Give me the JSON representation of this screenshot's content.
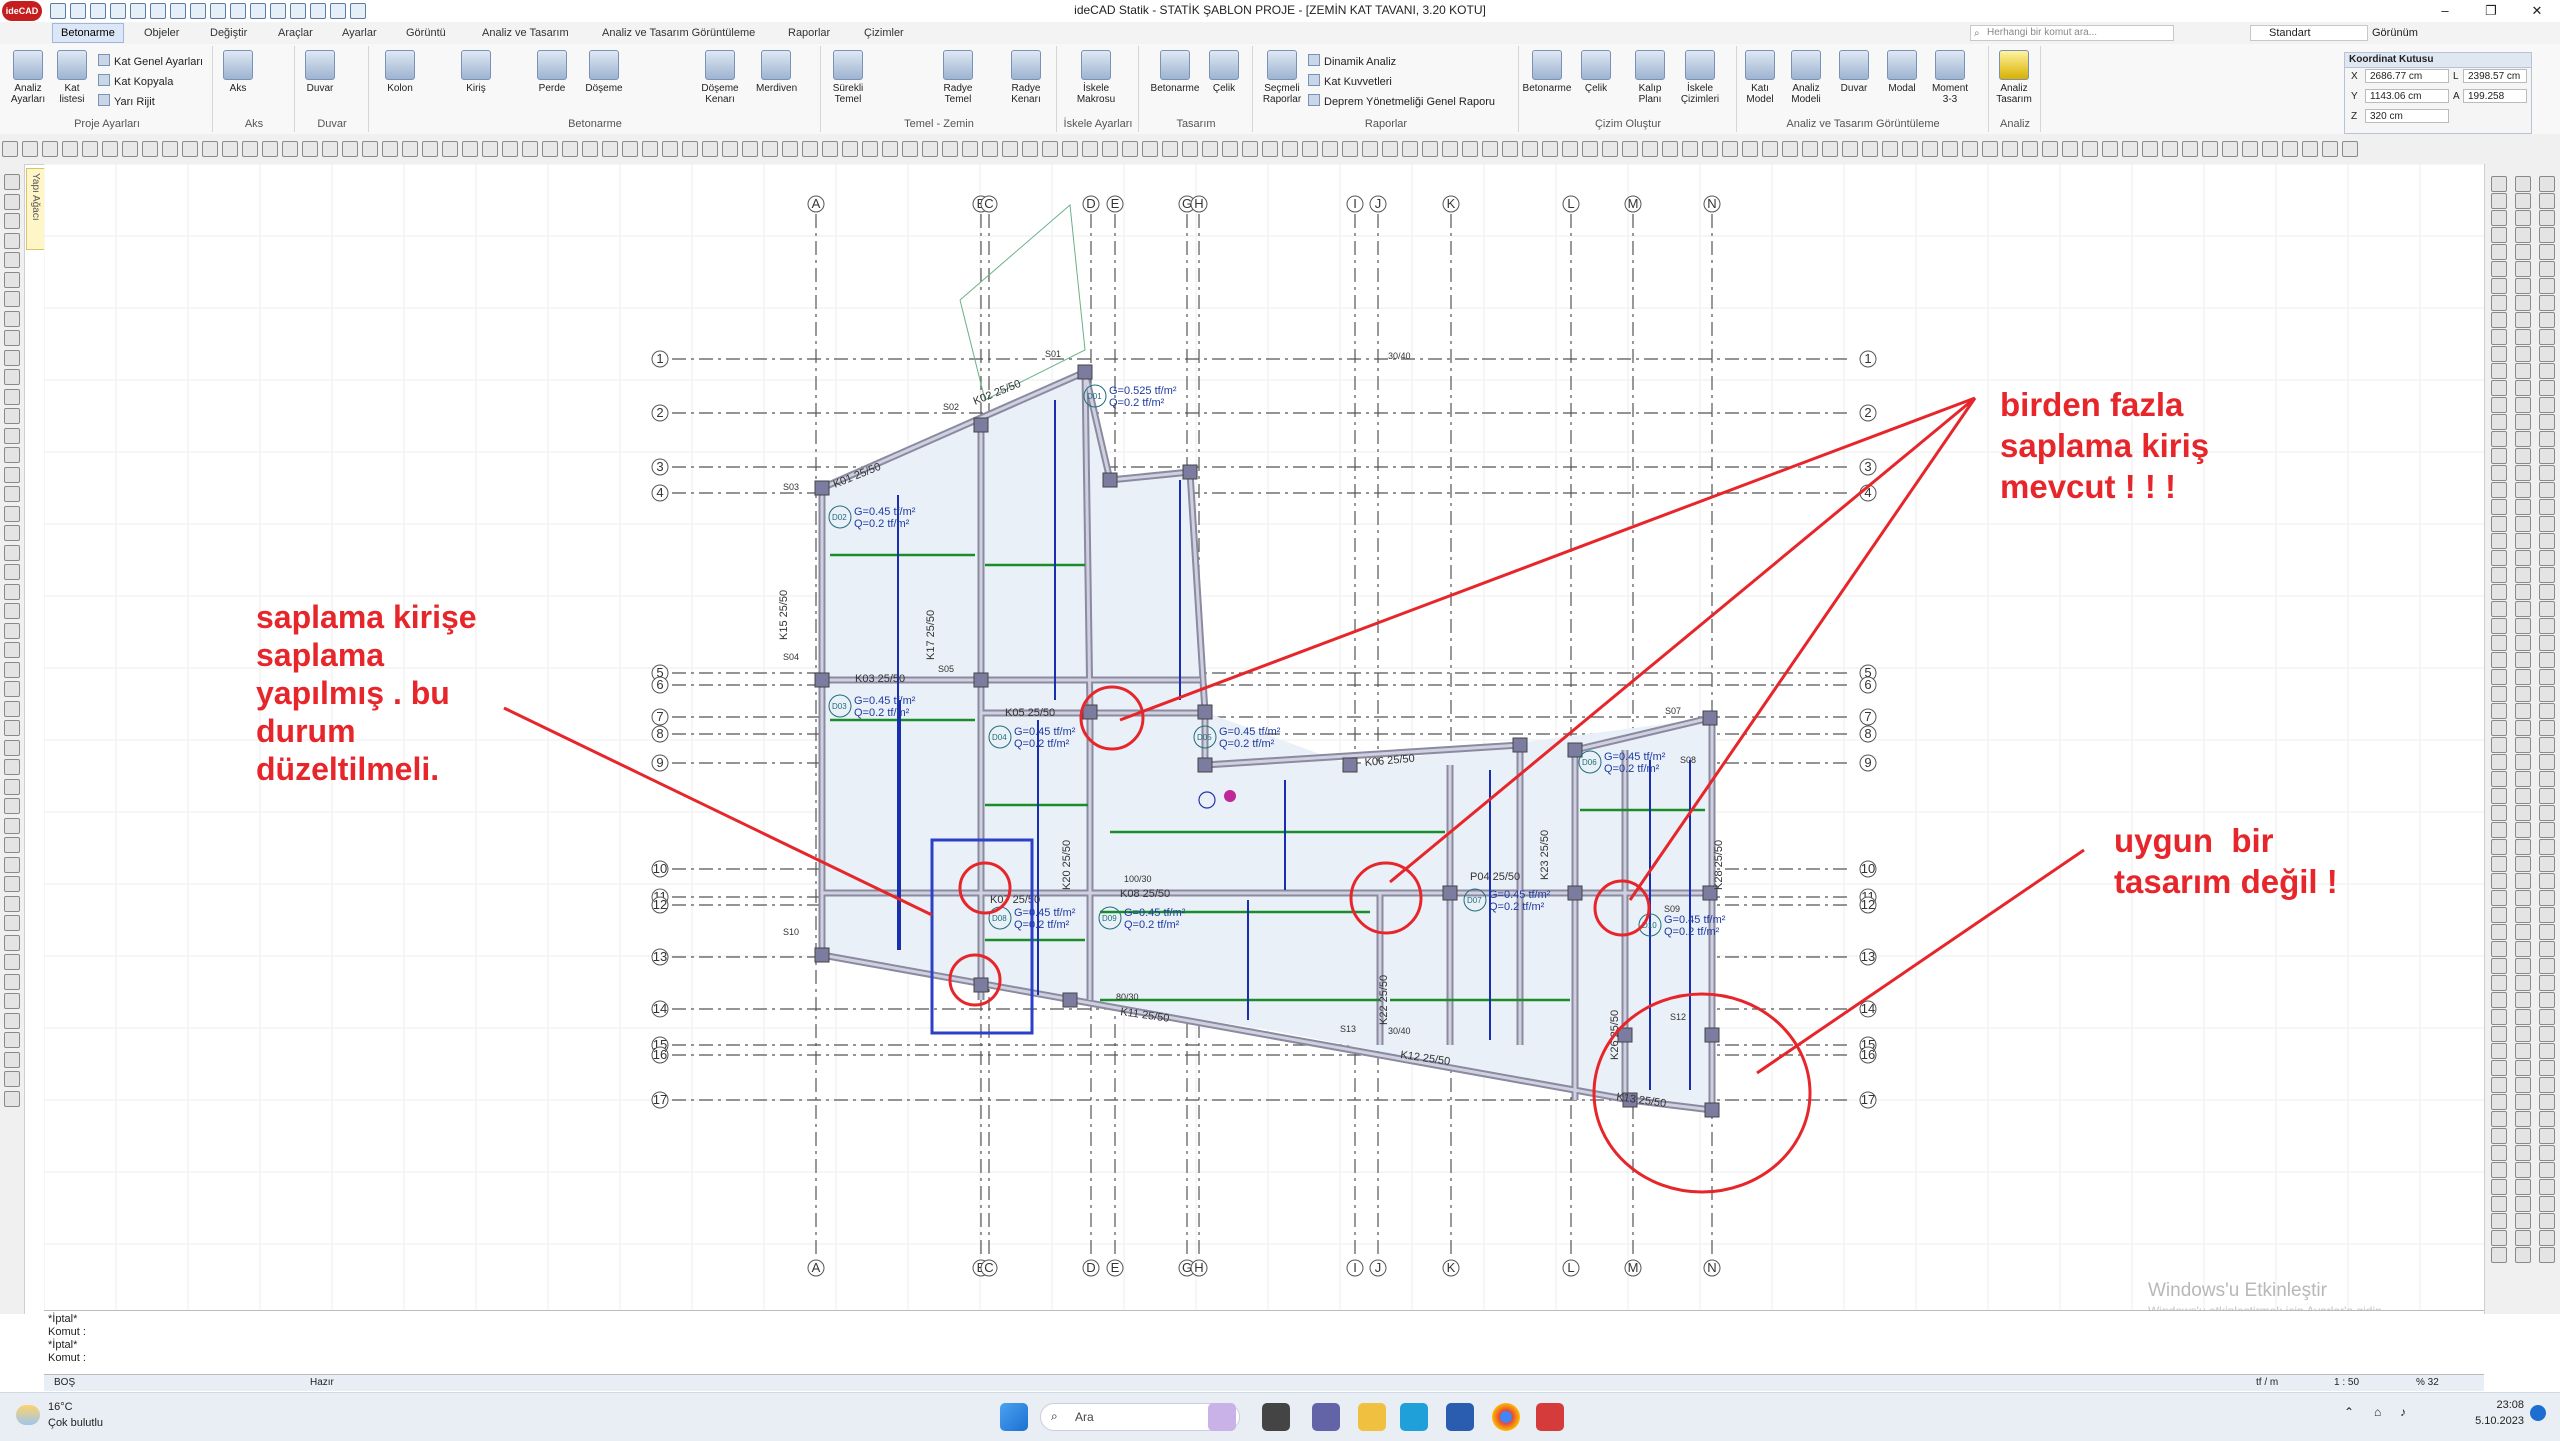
{
  "app": {
    "title": "ideCAD Statik - STATİK ŞABLON PROJE - [ZEMİN KAT TAVANI,  3.20 KOTU]",
    "logo": "ideCAD"
  },
  "tabs": [
    "Betonarme",
    "Objeler",
    "Değiştir",
    "Araçlar",
    "Ayarlar",
    "Görüntü",
    "Analiz ve Tasarım",
    "Analiz ve Tasarım Görüntüleme",
    "Raporlar",
    "Çizimler"
  ],
  "search": {
    "placeholder": "Herhangi bir komut ara..."
  },
  "view_select": "Standart",
  "view_label": "Görünüm",
  "ribbon": {
    "groups": [
      {
        "label": "Proje Ayarları",
        "buttons": [
          "Analiz Ayarları",
          "Kat listesi"
        ],
        "small": [
          "Kat Genel Ayarları",
          "Kat Kopyala",
          "Yarı Rijit"
        ]
      },
      {
        "label": "Aks",
        "buttons": [
          "Aks"
        ]
      },
      {
        "label": "Duvar",
        "buttons": [
          "Duvar"
        ]
      },
      {
        "label": "Betonarme",
        "buttons": [
          "Kolon",
          "Kiriş",
          "Perde",
          "Döşeme",
          "Döşeme Kenarı",
          "Merdiven"
        ]
      },
      {
        "label": "Temel - Zemin",
        "buttons": [
          "Sürekli Temel",
          "Radye Temel",
          "Radye Kenarı"
        ]
      },
      {
        "label": "İskele Ayarları",
        "buttons": [
          "İskele Makrosu"
        ]
      },
      {
        "label": "Tasarım",
        "buttons": [
          "Betonarme",
          "Çelik"
        ]
      },
      {
        "label": "Raporlar",
        "buttons": [
          "Seçmeli Raporlar"
        ],
        "small": [
          "Dinamik Analiz",
          "Kat Kuvvetleri",
          "Deprem Yönetmeliği Genel Raporu"
        ]
      },
      {
        "label": "Çizim Oluştur",
        "buttons": [
          "Betonarme",
          "Çelik",
          "Kalıp Planı",
          "İskele Çizimleri"
        ]
      },
      {
        "label": "Analiz ve Tasarım Görüntüleme",
        "buttons": [
          "Katı Model",
          "Analiz Modeli",
          "Duvar",
          "Modal",
          "Moment 3-3"
        ]
      },
      {
        "label": "Analiz",
        "buttons": [
          "Analiz Tasarım"
        ]
      }
    ]
  },
  "coord_box": {
    "title": "Koordinat Kutusu",
    "x": "2686.77 cm",
    "L": "2398.57 cm",
    "y": "1143.06 cm",
    "A": "199.258",
    "z": "320 cm"
  },
  "side_panel": "Yapı Ağacı",
  "axes": {
    "columns": [
      "A",
      "B",
      "C",
      "D",
      "E",
      "G",
      "H",
      "I",
      "J",
      "K",
      "L",
      "M",
      "N"
    ],
    "rows": [
      "1",
      "2",
      "3",
      "4",
      "5",
      "6",
      "7",
      "8",
      "9",
      "10",
      "11",
      "12",
      "13",
      "14",
      "15",
      "16",
      "17"
    ]
  },
  "slab_labels": [
    {
      "id": "D01",
      "g": "G=0.525 tf/m²",
      "q": "Q=0.2 tf/m²"
    },
    {
      "id": "D02",
      "g": "G=0.45 tf/m²",
      "q": "Q=0.2 tf/m²"
    },
    {
      "id": "D03",
      "g": "G=0.45 tf/m²",
      "q": "Q=0.2 tf/m²"
    },
    {
      "id": "D04",
      "g": "G=0.45 tf/m²",
      "q": "Q=0.2 tf/m²"
    },
    {
      "id": "D05",
      "g": "G=0.45 tf/m²",
      "q": "Q=0.2 tf/m²"
    },
    {
      "id": "D06",
      "g": "G=0.45 tf/m²",
      "q": "Q=0.2 tf/m²"
    },
    {
      "id": "D07",
      "g": "G=0.45 tf/m²",
      "q": "Q=0.2 tf/m²"
    },
    {
      "id": "D08",
      "g": "G=0.45 tf/m²",
      "q": "Q=0.2 tf/m²"
    },
    {
      "id": "D09",
      "g": "G=0.45 tf/m²",
      "q": "Q=0.2 tf/m²"
    },
    {
      "id": "D10",
      "g": "G=0.45 tf/m²",
      "q": "Q=0.2 tf/m²"
    }
  ],
  "beam_labels": [
    "K01 25/50",
    "K02 25/50",
    "K03 25/50",
    "K05 25/50",
    "K06 25/50",
    "K07 25/50",
    "K08 25/50",
    "K11 25/50",
    "K12 25/50",
    "K13 25/50",
    "K15 25/50",
    "K17 25/50",
    "K20 25/50",
    "K22 25/50",
    "K23 25/50",
    "K26 25/50",
    "K28 25/50",
    "P04 25/50"
  ],
  "column_labels": [
    "S01",
    "S02",
    "S03",
    "S04",
    "S05",
    "S07",
    "S08",
    "S09",
    "S10",
    "S12",
    "S13",
    "30/40",
    "100/30",
    "80/30",
    "30/40"
  ],
  "annotations": {
    "left": "saplama kirişe\nsaplama\nyapılmış . bu\ndurum\ndüzeltilmeli.",
    "top_right": "birden fazla\nsaplama kiriş\nmevcut ! ! !",
    "bottom_right": "uygun  bir\ntasarım değil !"
  },
  "watermark": {
    "line1": "Windows'u Etkinleştir",
    "line2": "Windows'u etkinleştirmek için Ayarlar'a gidin."
  },
  "command_lines": [
    "*İptal*",
    "Komut :",
    "*İptal*",
    "Komut :"
  ],
  "status": {
    "left": "BOŞ",
    "mid": "Hazır",
    "unit": "tf / m",
    "scale": "1 : 50",
    "zoom": "% 32"
  },
  "taskbar": {
    "weather_temp": "16°C",
    "weather_desc": "Çok bulutlu",
    "search": "Ara",
    "time": "23:08",
    "date": "5.10.2023"
  }
}
